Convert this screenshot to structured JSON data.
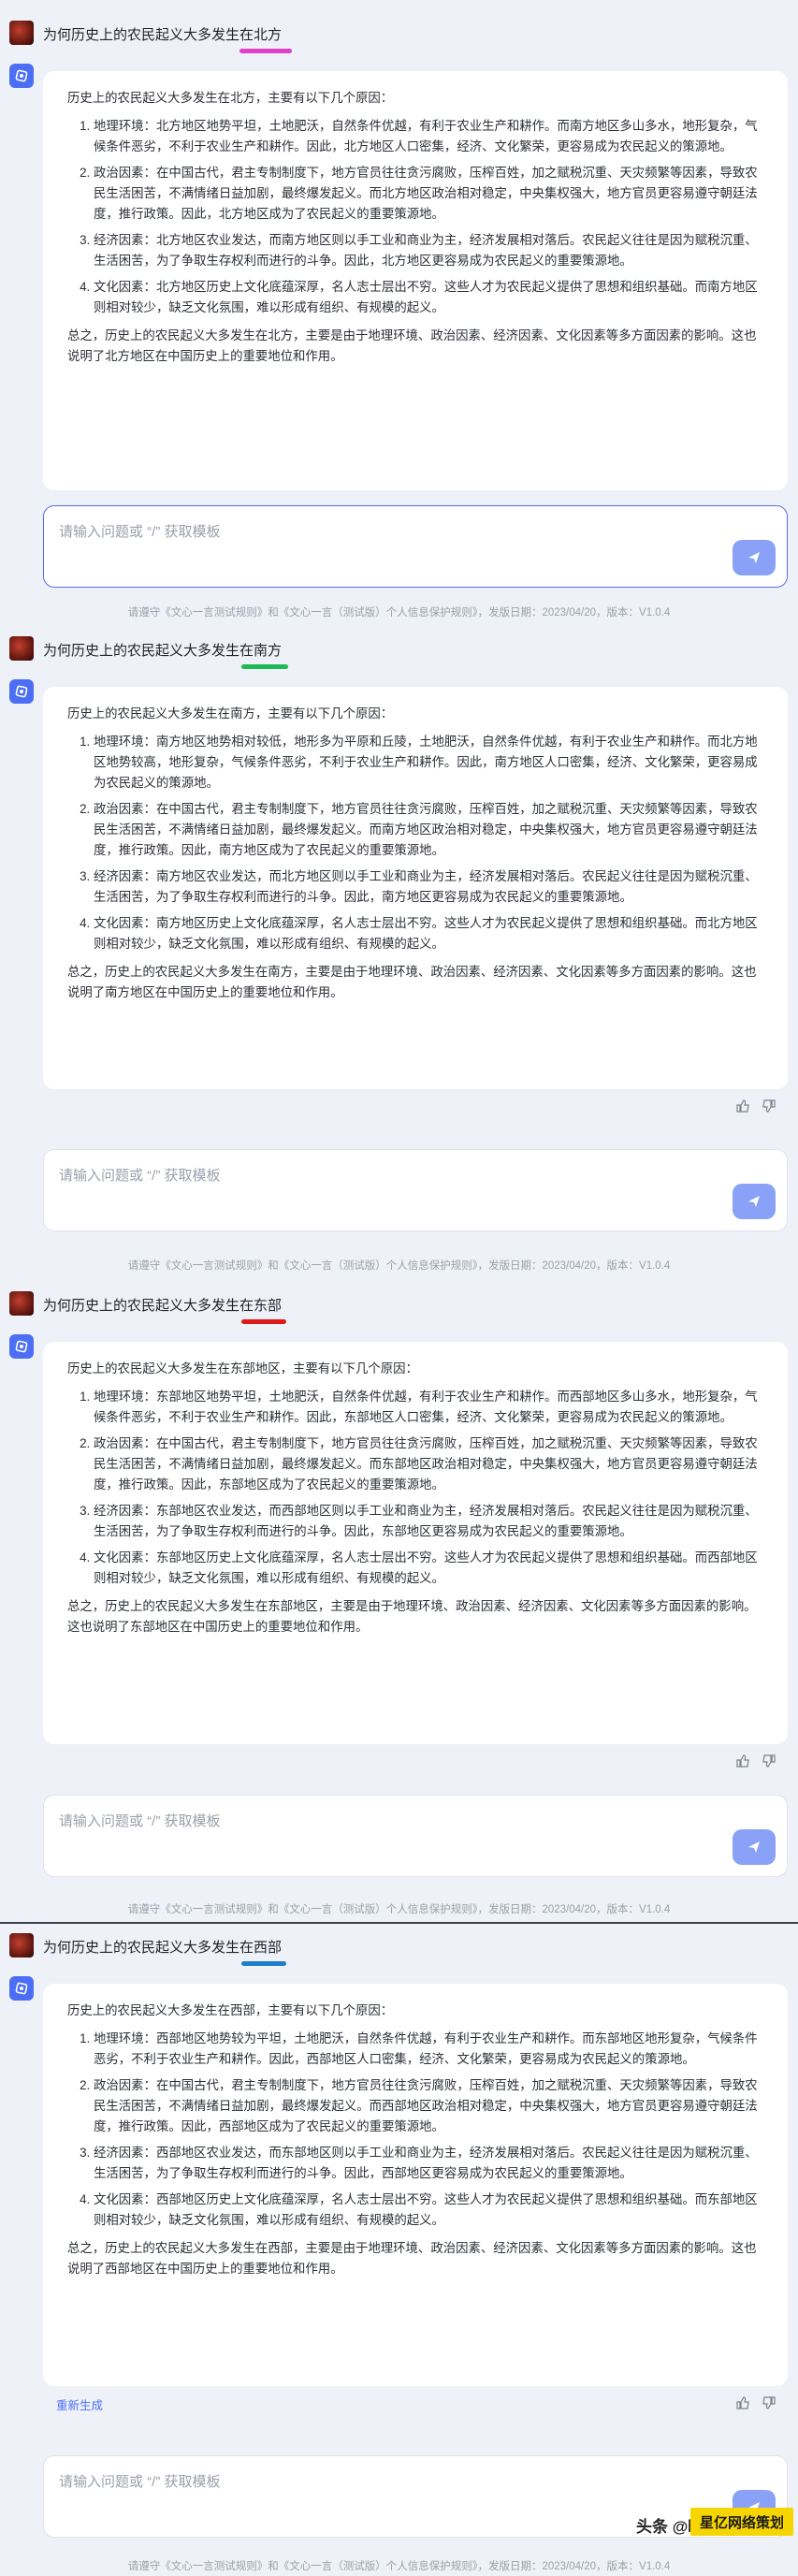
{
  "colors": {
    "accent": "#4c6ef5",
    "send_button": "#8aa1f8",
    "underline_north": "#e040c8",
    "underline_south": "#1db954",
    "underline_east": "#e01919",
    "underline_west": "#1e7fc8"
  },
  "input": {
    "placeholder": "请输入问题或 “/” 获取模板"
  },
  "footer": {
    "text": "请遵守《文心一言测试规则》和《文心一言（测试版）个人信息保护规则》，发版日期：2023/04/20，版本：V1.0.4"
  },
  "regenerate_label": "重新生成",
  "brand": {
    "text": "头条 @晓云风县",
    "badge": "星亿网络策划"
  },
  "panels": [
    {
      "question": "为何历史上的农民起义大多发生在北方",
      "answer": {
        "intro": "历史上的农民起义大多发生在北方，主要有以下几个原因：",
        "items": [
          "地理环境：北方地区地势平坦，土地肥沃，自然条件优越，有利于农业生产和耕作。而南方地区多山多水，地形复杂，气候条件恶劣，不利于农业生产和耕作。因此，北方地区人口密集，经济、文化繁荣，更容易成为农民起义的策源地。",
          "政治因素：在中国古代，君主专制制度下，地方官员往往贪污腐败，压榨百姓，加之赋税沉重、天灾频繁等因素，导致农民生活困苦，不满情绪日益加剧，最终爆发起义。而北方地区政治相对稳定，中央集权强大，地方官员更容易遵守朝廷法度，推行政策。因此，北方地区成为了农民起义的重要策源地。",
          "经济因素：北方地区农业发达，而南方地区则以手工业和商业为主，经济发展相对落后。农民起义往往是因为赋税沉重、生活困苦，为了争取生存权利而进行的斗争。因此，北方地区更容易成为农民起义的重要策源地。",
          "文化因素：北方地区历史上文化底蕴深厚，名人志士层出不穷。这些人才为农民起义提供了思想和组织基础。而南方地区则相对较少，缺乏文化氛围，难以形成有组织、有规模的起义。"
        ],
        "conclusion": "总之，历史上的农民起义大多发生在北方，主要是由于地理环境、政治因素、经济因素、文化因素等多方面因素的影响。这也说明了北方地区在中国历史上的重要地位和作用。"
      }
    },
    {
      "question": "为何历史上的农民起义大多发生在南方",
      "answer": {
        "intro": "历史上的农民起义大多发生在南方，主要有以下几个原因：",
        "items": [
          "地理环境：南方地区地势相对较低，地形多为平原和丘陵，土地肥沃，自然条件优越，有利于农业生产和耕作。而北方地区地势较高，地形复杂，气候条件恶劣，不利于农业生产和耕作。因此，南方地区人口密集，经济、文化繁荣，更容易成为农民起义的策源地。",
          "政治因素：在中国古代，君主专制制度下，地方官员往往贪污腐败，压榨百姓，加之赋税沉重、天灾频繁等因素，导致农民生活困苦，不满情绪日益加剧，最终爆发起义。而南方地区政治相对稳定，中央集权强大，地方官员更容易遵守朝廷法度，推行政策。因此，南方地区成为了农民起义的重要策源地。",
          "经济因素：南方地区农业发达，而北方地区则以手工业和商业为主，经济发展相对落后。农民起义往往是因为赋税沉重、生活困苦，为了争取生存权利而进行的斗争。因此，南方地区更容易成为农民起义的重要策源地。",
          "文化因素：南方地区历史上文化底蕴深厚，名人志士层出不穷。这些人才为农民起义提供了思想和组织基础。而北方地区则相对较少，缺乏文化氛围，难以形成有组织、有规模的起义。"
        ],
        "conclusion": "总之，历史上的农民起义大多发生在南方，主要是由于地理环境、政治因素、经济因素、文化因素等多方面因素的影响。这也说明了南方地区在中国历史上的重要地位和作用。"
      }
    },
    {
      "question": "为何历史上的农民起义大多发生在东部",
      "answer": {
        "intro": "历史上的农民起义大多发生在东部地区，主要有以下几个原因：",
        "items": [
          "地理环境：东部地区地势平坦，土地肥沃，自然条件优越，有利于农业生产和耕作。而西部地区多山多水，地形复杂，气候条件恶劣，不利于农业生产和耕作。因此，东部地区人口密集，经济、文化繁荣，更容易成为农民起义的策源地。",
          "政治因素：在中国古代，君主专制制度下，地方官员往往贪污腐败，压榨百姓，加之赋税沉重、天灾频繁等因素，导致农民生活困苦，不满情绪日益加剧，最终爆发起义。而东部地区政治相对稳定，中央集权强大，地方官员更容易遵守朝廷法度，推行政策。因此，东部地区成为了农民起义的重要策源地。",
          "经济因素：东部地区农业发达，而西部地区则以手工业和商业为主，经济发展相对落后。农民起义往往是因为赋税沉重、生活困苦，为了争取生存权利而进行的斗争。因此，东部地区更容易成为农民起义的重要策源地。",
          "文化因素：东部地区历史上文化底蕴深厚，名人志士层出不穷。这些人才为农民起义提供了思想和组织基础。而西部地区则相对较少，缺乏文化氛围，难以形成有组织、有规模的起义。"
        ],
        "conclusion": "总之，历史上的农民起义大多发生在东部地区，主要是由于地理环境、政治因素、经济因素、文化因素等多方面因素的影响。这也说明了东部地区在中国历史上的重要地位和作用。"
      }
    },
    {
      "question": "为何历史上的农民起义大多发生在西部",
      "answer": {
        "intro": "历史上的农民起义大多发生在西部，主要有以下几个原因：",
        "items": [
          "地理环境：西部地区地势较为平坦，土地肥沃，自然条件优越，有利于农业生产和耕作。而东部地区地形复杂，气候条件恶劣，不利于农业生产和耕作。因此，西部地区人口密集，经济、文化繁荣，更容易成为农民起义的策源地。",
          "政治因素：在中国古代，君主专制制度下，地方官员往往贪污腐败，压榨百姓，加之赋税沉重、天灾频繁等因素，导致农民生活困苦，不满情绪日益加剧，最终爆发起义。而西部地区政治相对稳定，中央集权强大，地方官员更容易遵守朝廷法度，推行政策。因此，西部地区成为了农民起义的重要策源地。",
          "经济因素：西部地区农业发达，而东部地区则以手工业和商业为主，经济发展相对落后。农民起义往往是因为赋税沉重、生活困苦，为了争取生存权利而进行的斗争。因此，西部地区更容易成为农民起义的重要策源地。",
          "文化因素：西部地区历史上文化底蕴深厚，名人志士层出不穷。这些人才为农民起义提供了思想和组织基础。而东部地区则相对较少，缺乏文化氛围，难以形成有组织、有规模的起义。"
        ],
        "conclusion": "总之，历史上的农民起义大多发生在西部，主要是由于地理环境、政治因素、经济因素、文化因素等多方面因素的影响。这也说明了西部地区在中国历史上的重要地位和作用。"
      }
    }
  ]
}
